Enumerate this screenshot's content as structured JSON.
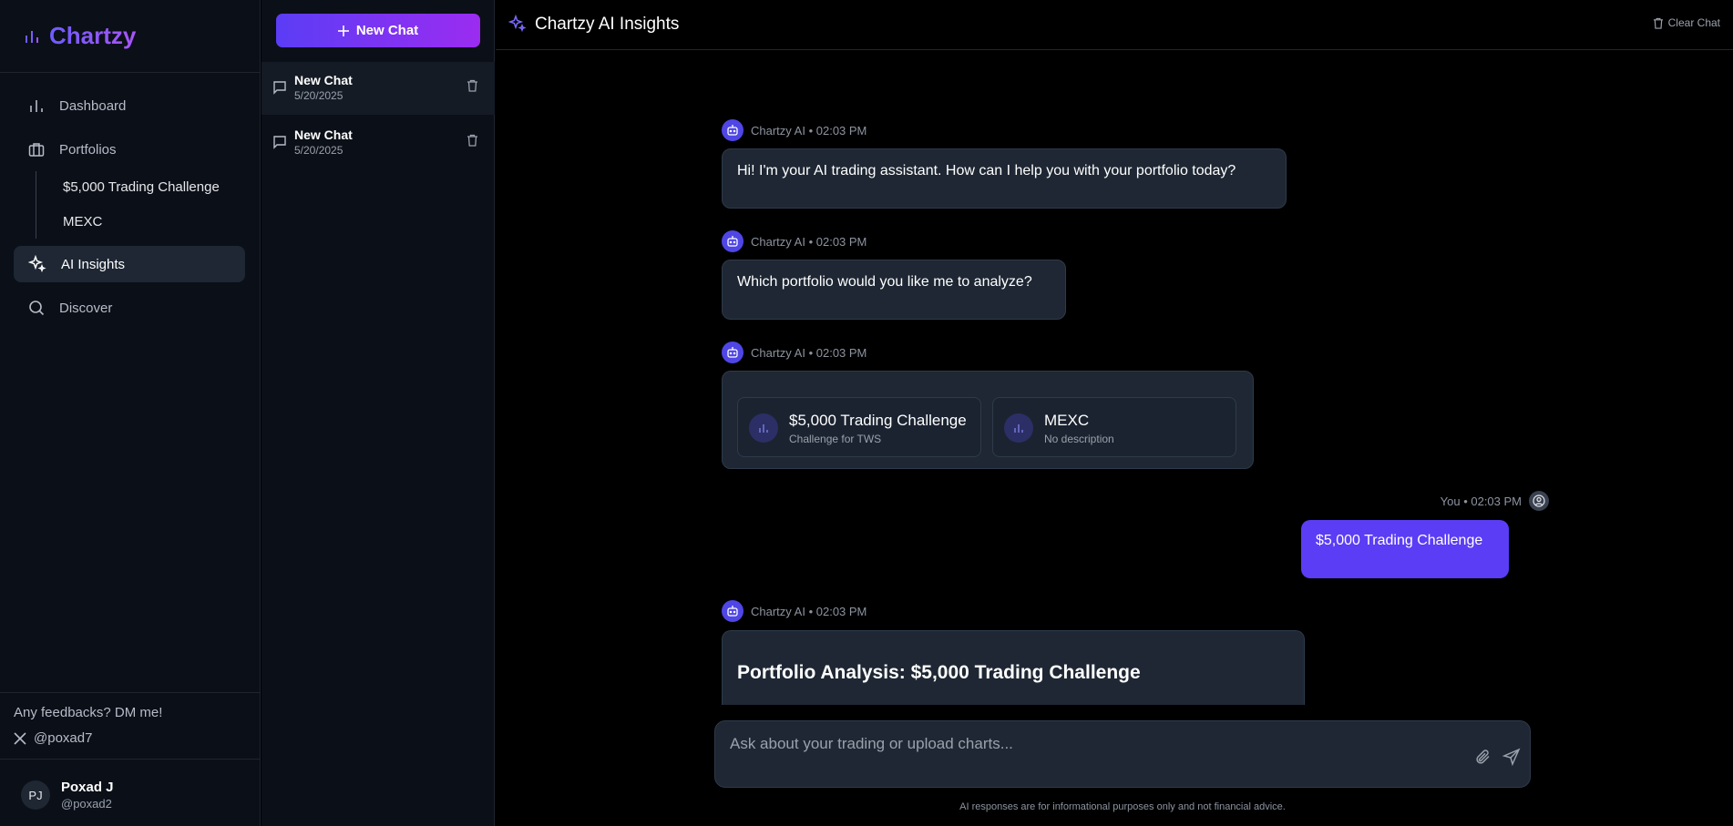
{
  "sidebar": {
    "brand": "Chartzy",
    "nav": {
      "dashboard": "Dashboard",
      "portfolios": "Portfolios",
      "ai_insights": "AI Insights",
      "discover": "Discover"
    },
    "portfolios": [
      "$5,000 Trading Challenge",
      "MEXC"
    ],
    "feedback": "Any feedbacks? DM me!",
    "x_handle": "@poxad7",
    "user": {
      "initials": "PJ",
      "name": "Poxad J",
      "handle": "@poxad2"
    }
  },
  "chatlist": {
    "new_chat_label": "New Chat",
    "items": [
      {
        "title": "New Chat",
        "date": "5/20/2025"
      },
      {
        "title": "New Chat",
        "date": "5/20/2025"
      }
    ]
  },
  "header": {
    "title": "Chartzy AI Insights",
    "clear_label": "Clear Chat"
  },
  "messages": {
    "m1": {
      "meta": "Chartzy AI • 02:03 PM",
      "text": "Hi! I'm your AI trading assistant. How can I help you with your portfolio today?"
    },
    "m2": {
      "meta": "Chartzy AI • 02:03 PM",
      "text": "Which portfolio would you like me to analyze?"
    },
    "m3": {
      "meta": "Chartzy AI • 02:03 PM",
      "cards": [
        {
          "name": "$5,000 Trading Challenge",
          "desc": "Challenge for TWS"
        },
        {
          "name": "MEXC",
          "desc": "No description"
        }
      ]
    },
    "m4": {
      "meta": "You • 02:03 PM",
      "text": "$5,000 Trading Challenge"
    },
    "m5": {
      "meta": "Chartzy AI • 02:03 PM",
      "title": "Portfolio Analysis: $5,000 Trading Challenge"
    }
  },
  "composer": {
    "placeholder": "Ask about your trading or upload charts..."
  },
  "disclaimer": "AI responses are for informational purposes only and not financial advice.",
  "colors": {
    "accent": "#5b3df5",
    "accent2": "#9b2cf0",
    "bubble": "#1e2733",
    "bg": "#000000"
  }
}
